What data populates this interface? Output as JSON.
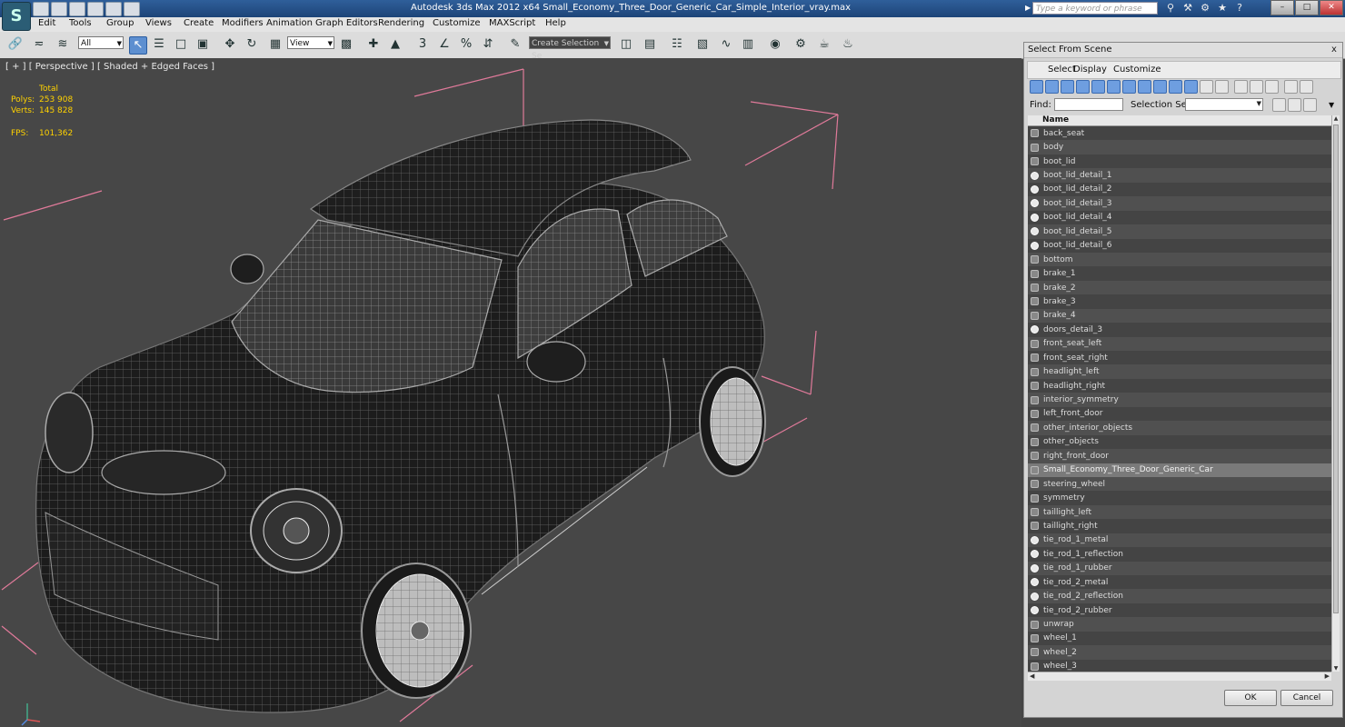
{
  "app": {
    "logo": "S",
    "title": "Autodesk 3ds Max  2012 x64      Small_Economy_Three_Door_Generic_Car_Simple_Interior_vray.max",
    "search_placeholder": "Type a keyword or phrase"
  },
  "menu": [
    "Edit",
    "Tools",
    "Group",
    "Views",
    "Create",
    "Modifiers",
    "Animation",
    "Graph Editors",
    "Rendering",
    "Customize",
    "MAXScript",
    "Help"
  ],
  "toolbar": {
    "filter_value": "All",
    "coord_value": "View",
    "selection_set_placeholder": "Create Selection Se"
  },
  "viewport": {
    "label": "[ + ] [ Perspective ] [ Shaded + Edged Faces ]",
    "stats": {
      "total_label": "Total",
      "polys_label": "Polys:",
      "polys_value": "253 908",
      "verts_label": "Verts:",
      "verts_value": "145 828",
      "fps_label": "FPS:",
      "fps_value": "101,362"
    }
  },
  "dialog": {
    "title": "Select From Scene",
    "close": "x",
    "menu": [
      "Select",
      "Display",
      "Customize"
    ],
    "find_label": "Find:",
    "selection_set_label": "Selection Set:",
    "column_header": "Name",
    "ok_label": "OK",
    "cancel_label": "Cancel",
    "selected_item": "Small_Economy_Three_Door_Generic_Car",
    "items": [
      {
        "name": "back_seat",
        "icon": "mesh"
      },
      {
        "name": "body",
        "icon": "mesh"
      },
      {
        "name": "boot_lid",
        "icon": "mesh"
      },
      {
        "name": "boot_lid_detail_1",
        "icon": "sphere"
      },
      {
        "name": "boot_lid_detail_2",
        "icon": "sphere"
      },
      {
        "name": "boot_lid_detail_3",
        "icon": "sphere"
      },
      {
        "name": "boot_lid_detail_4",
        "icon": "sphere"
      },
      {
        "name": "boot_lid_detail_5",
        "icon": "sphere"
      },
      {
        "name": "boot_lid_detail_6",
        "icon": "sphere"
      },
      {
        "name": "bottom",
        "icon": "mesh"
      },
      {
        "name": "brake_1",
        "icon": "mesh"
      },
      {
        "name": "brake_2",
        "icon": "mesh"
      },
      {
        "name": "brake_3",
        "icon": "mesh"
      },
      {
        "name": "brake_4",
        "icon": "mesh"
      },
      {
        "name": "doors_detail_3",
        "icon": "sphere"
      },
      {
        "name": "front_seat_left",
        "icon": "mesh"
      },
      {
        "name": "front_seat_right",
        "icon": "mesh"
      },
      {
        "name": "headlight_left",
        "icon": "mesh"
      },
      {
        "name": "headlight_right",
        "icon": "mesh"
      },
      {
        "name": "interior_symmetry",
        "icon": "mesh"
      },
      {
        "name": "left_front_door",
        "icon": "mesh"
      },
      {
        "name": "other_interior_objects",
        "icon": "mesh"
      },
      {
        "name": "other_objects",
        "icon": "mesh"
      },
      {
        "name": "right_front_door",
        "icon": "mesh"
      },
      {
        "name": "Small_Economy_Three_Door_Generic_Car",
        "icon": "mesh"
      },
      {
        "name": "steering_wheel",
        "icon": "mesh"
      },
      {
        "name": "symmetry",
        "icon": "mesh"
      },
      {
        "name": "taillight_left",
        "icon": "mesh"
      },
      {
        "name": "taillight_right",
        "icon": "mesh"
      },
      {
        "name": "tie_rod_1_metal",
        "icon": "sphere"
      },
      {
        "name": "tie_rod_1_reflection",
        "icon": "sphere"
      },
      {
        "name": "tie_rod_1_rubber",
        "icon": "sphere"
      },
      {
        "name": "tie_rod_2_metal",
        "icon": "sphere"
      },
      {
        "name": "tie_rod_2_reflection",
        "icon": "sphere"
      },
      {
        "name": "tie_rod_2_rubber",
        "icon": "sphere"
      },
      {
        "name": "unwrap",
        "icon": "mesh"
      },
      {
        "name": "wheel_1",
        "icon": "mesh"
      },
      {
        "name": "wheel_2",
        "icon": "mesh"
      },
      {
        "name": "wheel_3",
        "icon": "mesh"
      }
    ]
  }
}
